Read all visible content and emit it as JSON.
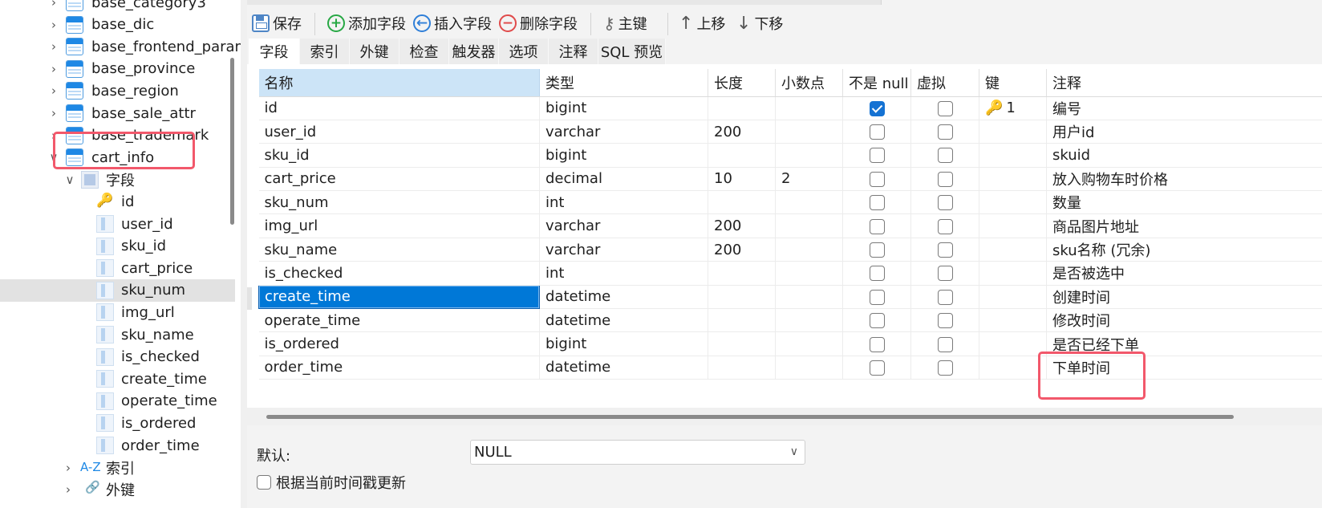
{
  "tree": {
    "tables": [
      {
        "label": "base_category3"
      },
      {
        "label": "base_dic"
      },
      {
        "label": "base_frontend_param"
      },
      {
        "label": "base_province"
      },
      {
        "label": "base_region"
      },
      {
        "label": "base_sale_attr"
      },
      {
        "label": "base_trademark"
      },
      {
        "label": "cart_info"
      }
    ],
    "fields_group_label": "字段",
    "columns": [
      "id",
      "user_id",
      "sku_id",
      "cart_price",
      "sku_num",
      "img_url",
      "sku_name",
      "is_checked",
      "create_time",
      "operate_time",
      "is_ordered",
      "order_time"
    ],
    "selected_column": "sku_num",
    "index_group_label": "索引",
    "fk_group_label": "外键"
  },
  "toolbar": {
    "save": "保存",
    "add_field": "添加字段",
    "insert_field": "插入字段",
    "delete_field": "删除字段",
    "primary_key": "主键",
    "move_up": "上移",
    "move_down": "下移"
  },
  "subtabs": [
    "字段",
    "索引",
    "外键",
    "检查",
    "触发器",
    "选项",
    "注释",
    "SQL 预览"
  ],
  "grid": {
    "headers": [
      "名称",
      "类型",
      "长度",
      "小数点",
      "不是 null",
      "虚拟",
      "键",
      "注释"
    ],
    "rows": [
      {
        "name": "id",
        "type": "bigint",
        "length": "",
        "decimals": "",
        "not_null": true,
        "virtual": false,
        "key": "1",
        "comment": "编号"
      },
      {
        "name": "user_id",
        "type": "varchar",
        "length": "200",
        "decimals": "",
        "not_null": false,
        "virtual": false,
        "key": "",
        "comment": "用户id"
      },
      {
        "name": "sku_id",
        "type": "bigint",
        "length": "",
        "decimals": "",
        "not_null": false,
        "virtual": false,
        "key": "",
        "comment": "skuid"
      },
      {
        "name": "cart_price",
        "type": "decimal",
        "length": "10",
        "decimals": "2",
        "not_null": false,
        "virtual": false,
        "key": "",
        "comment": "放入购物车时价格"
      },
      {
        "name": "sku_num",
        "type": "int",
        "length": "",
        "decimals": "",
        "not_null": false,
        "virtual": false,
        "key": "",
        "comment": "数量"
      },
      {
        "name": "img_url",
        "type": "varchar",
        "length": "200",
        "decimals": "",
        "not_null": false,
        "virtual": false,
        "key": "",
        "comment": "商品图片地址"
      },
      {
        "name": "sku_name",
        "type": "varchar",
        "length": "200",
        "decimals": "",
        "not_null": false,
        "virtual": false,
        "key": "",
        "comment": "sku名称 (冗余)"
      },
      {
        "name": "is_checked",
        "type": "int",
        "length": "",
        "decimals": "",
        "not_null": false,
        "virtual": false,
        "key": "",
        "comment": "是否被选中"
      },
      {
        "name": "create_time",
        "type": "datetime",
        "length": "",
        "decimals": "",
        "not_null": false,
        "virtual": false,
        "key": "",
        "comment": "创建时间"
      },
      {
        "name": "operate_time",
        "type": "datetime",
        "length": "",
        "decimals": "",
        "not_null": false,
        "virtual": false,
        "key": "",
        "comment": "修改时间"
      },
      {
        "name": "is_ordered",
        "type": "bigint",
        "length": "",
        "decimals": "",
        "not_null": false,
        "virtual": false,
        "key": "",
        "comment": "是否已经下单"
      },
      {
        "name": "order_time",
        "type": "datetime",
        "length": "",
        "decimals": "",
        "not_null": false,
        "virtual": false,
        "key": "",
        "comment": "下单时间"
      }
    ],
    "selected_row": "create_time"
  },
  "bottom": {
    "default_label": "默认:",
    "default_value": "NULL",
    "update_on_timestamp_label": "根据当前时间戳更新"
  },
  "colors": {
    "selection": "#0078d7",
    "highlight_box": "#f2586b",
    "key_icon": "#e9a400"
  }
}
